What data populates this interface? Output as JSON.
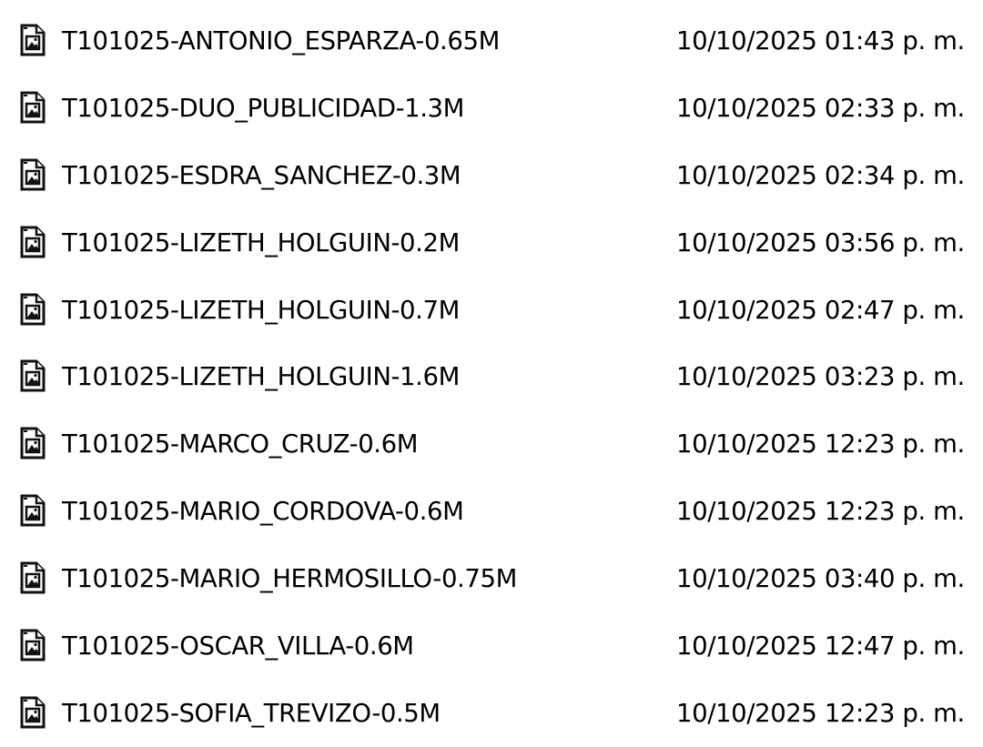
{
  "files": [
    {
      "name": "T101025-ANTONIO_ESPARZA-0.65M",
      "modified": "10/10/2025 01:43 p. m.",
      "icon": "image-file-icon"
    },
    {
      "name": "T101025-DUO_PUBLICIDAD-1.3M",
      "modified": "10/10/2025 02:33 p. m.",
      "icon": "image-file-icon"
    },
    {
      "name": "T101025-ESDRA_SANCHEZ-0.3M",
      "modified": "10/10/2025 02:34 p. m.",
      "icon": "image-file-icon"
    },
    {
      "name": "T101025-LIZETH_HOLGUIN-0.2M",
      "modified": "10/10/2025 03:56 p. m.",
      "icon": "image-file-icon"
    },
    {
      "name": "T101025-LIZETH_HOLGUIN-0.7M",
      "modified": "10/10/2025 02:47 p. m.",
      "icon": "image-file-icon"
    },
    {
      "name": "T101025-LIZETH_HOLGUIN-1.6M",
      "modified": "10/10/2025 03:23 p. m.",
      "icon": "image-file-icon"
    },
    {
      "name": "T101025-MARCO_CRUZ-0.6M",
      "modified": "10/10/2025 12:23 p. m.",
      "icon": "image-file-icon"
    },
    {
      "name": "T101025-MARIO_CORDOVA-0.6M",
      "modified": "10/10/2025 12:23 p. m.",
      "icon": "image-file-icon"
    },
    {
      "name": "T101025-MARIO_HERMOSILLO-0.75M",
      "modified": "10/10/2025 03:40 p. m.",
      "icon": "image-file-icon"
    },
    {
      "name": "T101025-OSCAR_VILLA-0.6M",
      "modified": "10/10/2025 12:47 p. m.",
      "icon": "image-file-icon"
    },
    {
      "name": "T101025-SOFIA_TREVIZO-0.5M",
      "modified": "10/10/2025 12:23 p. m.",
      "icon": "image-file-icon"
    }
  ]
}
